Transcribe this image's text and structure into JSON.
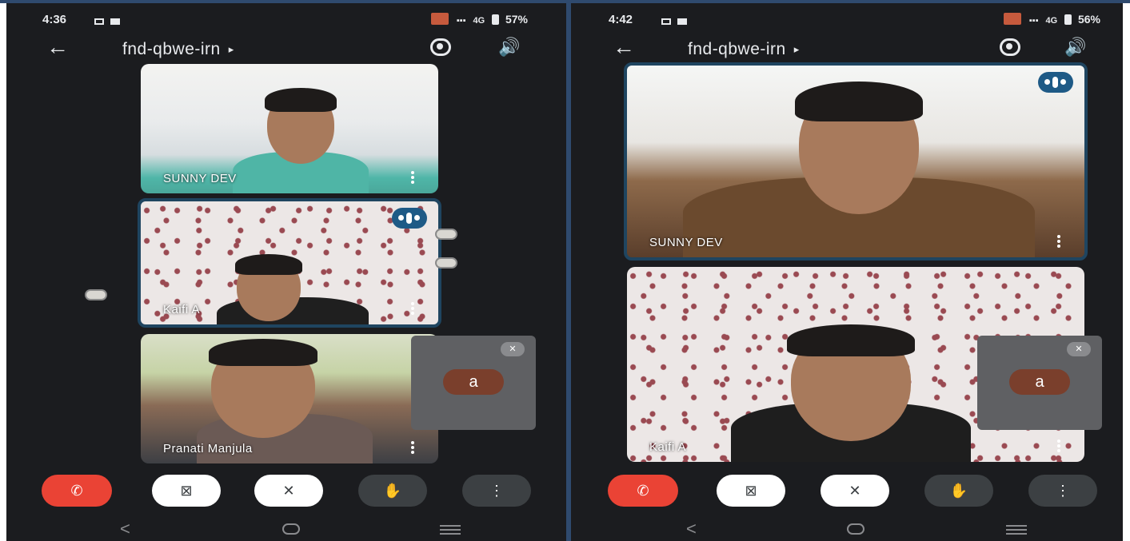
{
  "left": {
    "status": {
      "time": "4:36",
      "right": "57%",
      "network": "4G"
    },
    "header": {
      "meeting_code": "fnd-qbwe-irn",
      "arrow": "▸"
    },
    "tiles": [
      {
        "name": "SUNNY DEV"
      },
      {
        "name": "Kaifi A"
      },
      {
        "name": "Pranati Manjula"
      }
    ],
    "self": {
      "avatar_letter": "a"
    }
  },
  "right": {
    "status": {
      "time": "4:42",
      "right": "56%",
      "network": "4G"
    },
    "header": {
      "meeting_code": "fnd-qbwe-irn",
      "arrow": "▸"
    },
    "tiles": [
      {
        "name": "SUNNY DEV"
      },
      {
        "name": "Kaifi A"
      }
    ],
    "self": {
      "avatar_letter": "a"
    }
  },
  "icons": {
    "back": "←",
    "speaker": "🔊",
    "end_call": "✆",
    "camera_off": "⊠",
    "mic_off": "✕",
    "raise_hand": "✋",
    "more": "⋮",
    "nav_back": "<"
  },
  "colors": {
    "end_call": "#ea4335",
    "active_border": "#1f4560",
    "speaking_indicator": "#1e5a86",
    "avatar": "#7a3f2c",
    "divider": "#2f4a6e"
  }
}
